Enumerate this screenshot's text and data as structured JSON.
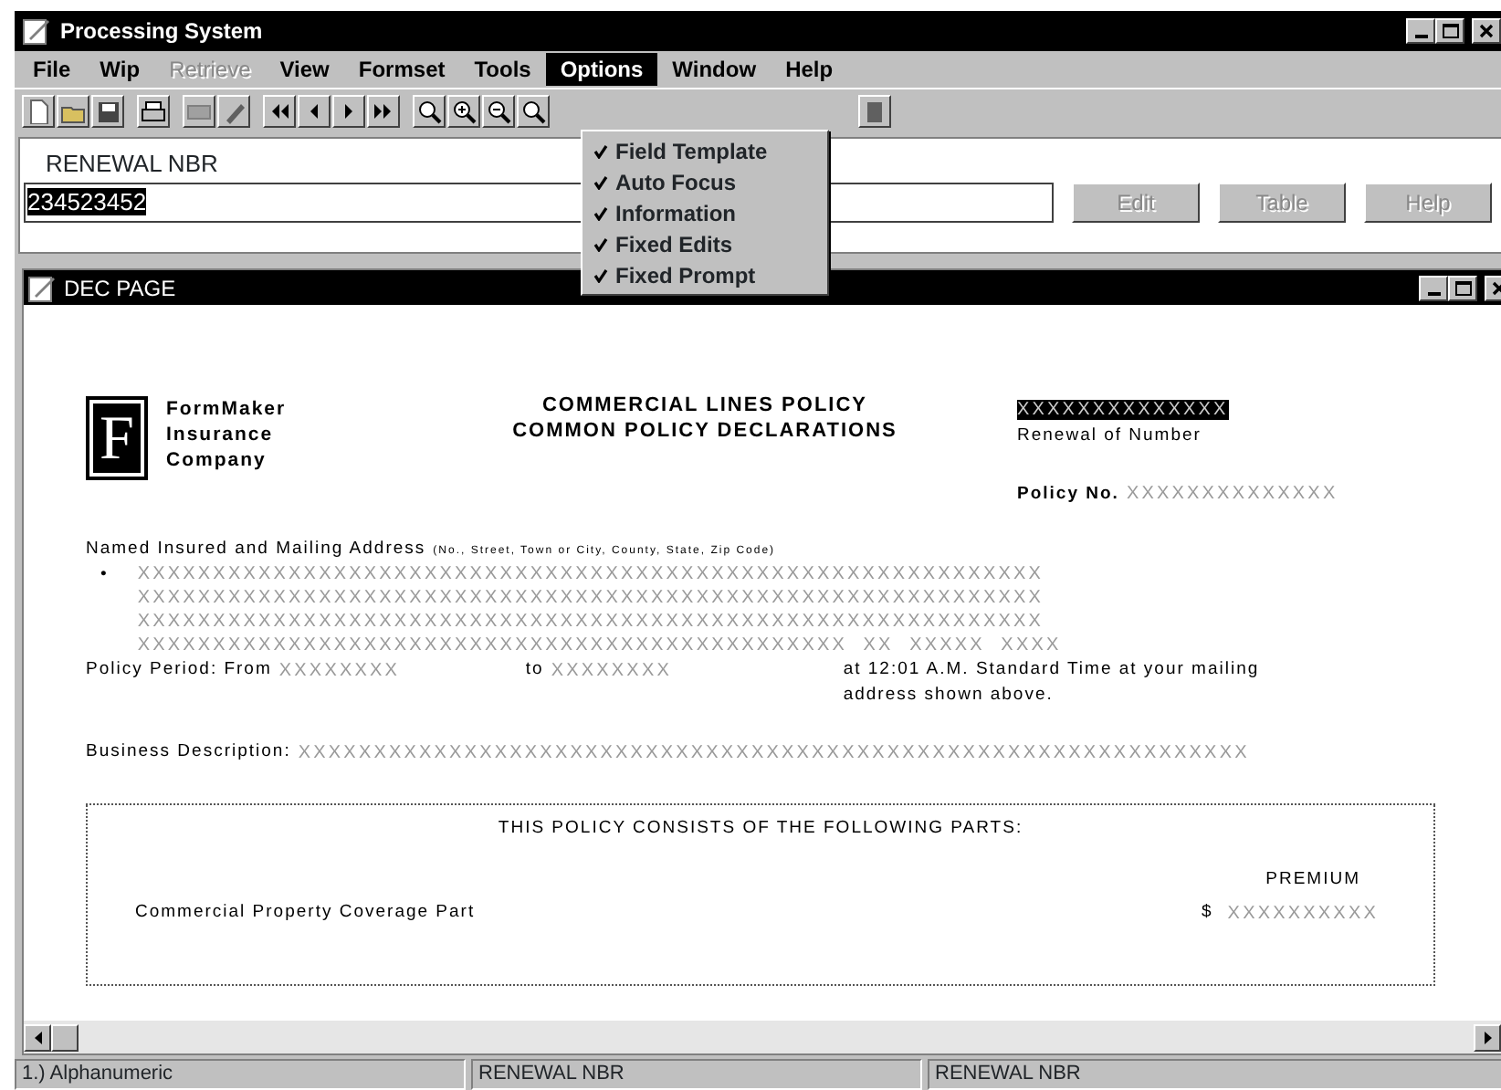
{
  "window": {
    "title": "Processing System"
  },
  "menu": [
    {
      "label": "File",
      "disabled": false,
      "selected": false
    },
    {
      "label": "Wip",
      "disabled": false,
      "selected": false
    },
    {
      "label": "Retrieve",
      "disabled": true,
      "selected": false
    },
    {
      "label": "View",
      "disabled": false,
      "selected": false
    },
    {
      "label": "Formset",
      "disabled": false,
      "selected": false
    },
    {
      "label": "Tools",
      "disabled": false,
      "selected": false
    },
    {
      "label": "Options",
      "disabled": false,
      "selected": true
    },
    {
      "label": "Window",
      "disabled": false,
      "selected": false
    },
    {
      "label": "Help",
      "disabled": false,
      "selected": false
    }
  ],
  "options_menu": [
    {
      "label": "Field Template",
      "checked": true
    },
    {
      "label": "Auto Focus",
      "checked": true
    },
    {
      "label": "Information",
      "checked": true
    },
    {
      "label": "Fixed Edits",
      "checked": true
    },
    {
      "label": "Fixed Prompt",
      "checked": true
    }
  ],
  "prompt": {
    "label": "RENEWAL NBR",
    "value": "234523452",
    "value_selected": true,
    "buttons": [
      {
        "label": "Edit",
        "disabled": true
      },
      {
        "label": "Table",
        "disabled": true
      },
      {
        "label": "Help",
        "disabled": true
      }
    ]
  },
  "document_window": {
    "title": "DEC PAGE"
  },
  "document": {
    "logo_letter": "F",
    "company": [
      "FormMaker",
      "Insurance",
      "Company"
    ],
    "title": [
      "COMMERCIAL LINES POLICY",
      "COMMON POLICY DECLARATIONS"
    ],
    "renewal_field": {
      "value": "XXXXXXXXXXXXXX",
      "selected": true
    },
    "renewal_label": "Renewal of Number",
    "policy_label": "Policy No.",
    "policy_field": {
      "value": "XXXXXXXXXXXXXX",
      "selected": false
    },
    "address_label": "Named Insured and Mailing Address",
    "address_hint": "(No., Street, Town or City, County, State, Zip Code)",
    "address_bullet": "•",
    "address_lines": [
      {
        "value": "XXXXXXXXXXXXXXXXXXXXXXXXXXXXXXXXXXXXXXXXXXXXXXXXXXXXXXXXXXXX",
        "selected": false
      },
      {
        "value": "XXXXXXXXXXXXXXXXXXXXXXXXXXXXXXXXXXXXXXXXXXXXXXXXXXXXXXXXXXXX",
        "selected": false
      },
      {
        "value": "XXXXXXXXXXXXXXXXXXXXXXXXXXXXXXXXXXXXXXXXXXXXXXXXXXXXXXXXXXXX",
        "selected": false
      },
      {
        "value": "XXXXXXXXXXXXXXXXXXXXXXXXXXXXXXXXXXXXXXXXXXXXXXX  XX  XXXXX  XXXX",
        "selected": false
      }
    ],
    "period_from_label": "Policy Period: From",
    "period_from": {
      "value": "XXXXXXXX",
      "selected": false
    },
    "period_to_label": "to",
    "period_to": {
      "value": "XXXXXXXX",
      "selected": false
    },
    "time_note": "at 12:01 A.M. Standard Time at your mailing address shown above.",
    "business_label": "Business Description:",
    "business_field": {
      "value": "XXXXXXXXXXXXXXXXXXXXXXXXXXXXXXXXXXXXXXXXXXXXXXXXXXXXXXXXXXXXXXX",
      "selected": false
    },
    "parts_heading": "THIS POLICY CONSISTS OF THE FOLLOWING PARTS:",
    "premium_heading": "PREMIUM",
    "parts": [
      {
        "name": "Commercial Property Coverage Part",
        "currency": "$",
        "premium": {
          "value": "XXXXXXXXXX",
          "selected": false
        }
      }
    ]
  },
  "status_bar": [
    "1.) Alphanumeric",
    "RENEWAL NBR",
    "RENEWAL NBR"
  ]
}
